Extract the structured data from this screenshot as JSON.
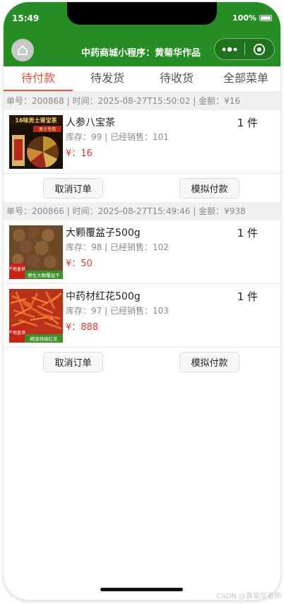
{
  "status": {
    "time": "15:49",
    "battery": "100%"
  },
  "nav": {
    "title": "中药商城小程序：黄菊华作品"
  },
  "tabs": [
    {
      "label": "待付款",
      "active": true
    },
    {
      "label": "待发货",
      "active": false
    },
    {
      "label": "待收货",
      "active": false
    },
    {
      "label": "全部菜单",
      "active": false
    }
  ],
  "orders": [
    {
      "header": "单号：200868 | 时间：2025-08-27T15:50:02 | 金额：¥16",
      "items": [
        {
          "name": "人参八宝茶",
          "stock": "库存：99 | 已经销售：101",
          "price": "¥：16",
          "qty": "1 件",
          "thumb_title": "16味男士肾宝茶",
          "thumb_sub": "男士专用"
        }
      ],
      "cancel_label": "取消订单",
      "pay_label": "模拟付款"
    },
    {
      "header": "单号：200866 | 时间：2025-08-27T15:49:46 | 金额：¥938",
      "items": [
        {
          "name": "大颗覆盆子500g",
          "stock": "库存：98 | 已经销售：102",
          "price": "¥：50",
          "qty": "1 件",
          "thumb_tag": "产地直供",
          "thumb_sub": "野生大颗覆盆子"
        },
        {
          "name": "中药材红花500g",
          "stock": "库存：97 | 已经销售：103",
          "price": "¥：888",
          "qty": "1 件",
          "thumb_tag": "产地直供",
          "thumb_sub": "精选特级红花"
        }
      ],
      "cancel_label": "取消订单",
      "pay_label": "模拟付款"
    }
  ],
  "watermark": "CSDN @黄菊华老师",
  "colors": {
    "brand_green": "#258d23",
    "accent": "#e4533a",
    "price_red": "#e0342b"
  }
}
